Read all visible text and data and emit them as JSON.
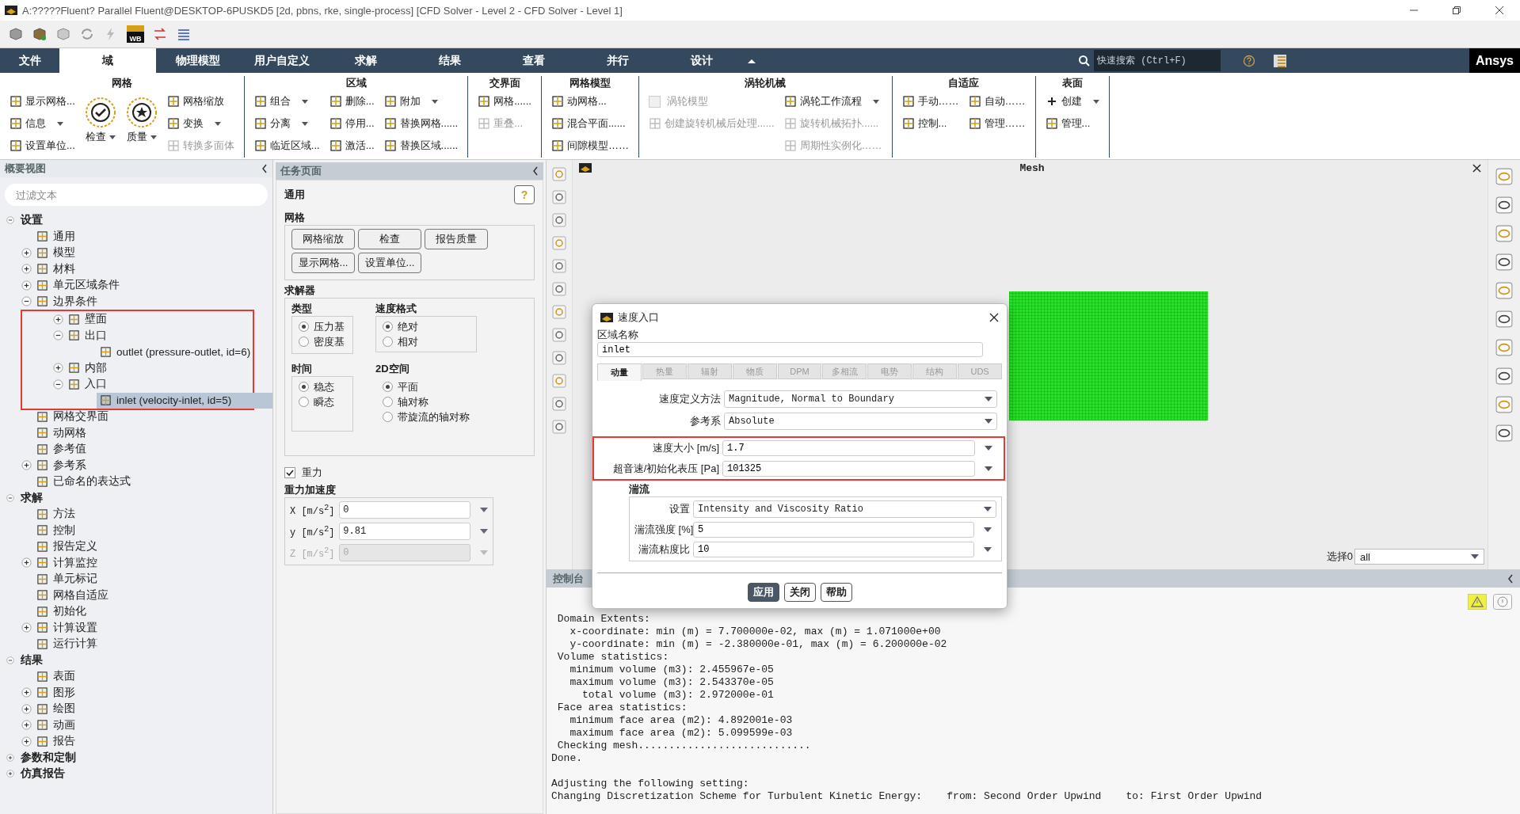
{
  "window": {
    "title": "A:?????Fluent? Parallel Fluent@DESKTOP-6PUSKD5  [2d, pbns, rke, single-process] [CFD Solver - Level 2 - CFD Solver - Level 1]"
  },
  "quick_toolbar": {
    "logo_label": "WB"
  },
  "menu_tabs": [
    {
      "label": "文件",
      "selected": false
    },
    {
      "label": "域",
      "selected": true
    },
    {
      "label": "物理模型",
      "selected": false
    },
    {
      "label": "用户自定义",
      "selected": false
    },
    {
      "label": "求解",
      "selected": false
    },
    {
      "label": "结果",
      "selected": false
    },
    {
      "label": "查看",
      "selected": false
    },
    {
      "label": "并行",
      "selected": false
    },
    {
      "label": "设计",
      "selected": false
    }
  ],
  "search": {
    "placeholder": "快速搜索 (Ctrl+F)"
  },
  "brand": "Ansys",
  "ribbon": [
    {
      "title": "网格",
      "columns": [
        [
          {
            "kind": "small",
            "label": "显示网格...",
            "caret": false,
            "disabled": false
          },
          {
            "kind": "small",
            "label": "信息",
            "caret": true,
            "disabled": false
          },
          {
            "kind": "small",
            "label": "设置单位...",
            "caret": false,
            "disabled": false
          }
        ],
        [
          {
            "kind": "check",
            "label": "检查",
            "caret": true,
            "disabled": false
          }
        ],
        [
          {
            "kind": "star",
            "label": "质量",
            "caret": true,
            "disabled": false
          }
        ],
        [
          {
            "kind": "small",
            "label": "网格缩放",
            "caret": false,
            "disabled": false
          },
          {
            "kind": "small",
            "label": "变换",
            "caret": true,
            "disabled": false
          },
          {
            "kind": "small",
            "label": "转换多面体",
            "caret": false,
            "disabled": true
          }
        ]
      ]
    },
    {
      "title": "区域",
      "columns": [
        [
          {
            "kind": "small",
            "label": "组合",
            "caret": true,
            "disabled": false
          },
          {
            "kind": "small",
            "label": "分离",
            "caret": true,
            "disabled": false
          },
          {
            "kind": "small",
            "label": "临近区域...",
            "caret": false,
            "disabled": false
          }
        ],
        [
          {
            "kind": "small",
            "label": "删除...",
            "caret": false,
            "disabled": false
          },
          {
            "kind": "small",
            "label": "停用...",
            "caret": false,
            "disabled": false
          },
          {
            "kind": "small",
            "label": "激活...",
            "caret": false,
            "disabled": false
          }
        ],
        [
          {
            "kind": "small",
            "label": "附加",
            "caret": true,
            "disabled": false
          },
          {
            "kind": "small",
            "label": "替换网格......",
            "caret": false,
            "disabled": false
          },
          {
            "kind": "small",
            "label": "替换区域......",
            "caret": false,
            "disabled": false
          }
        ]
      ]
    },
    {
      "title": "交界面",
      "columns": [
        [
          {
            "kind": "small",
            "label": "网格......",
            "caret": false,
            "disabled": false
          },
          {
            "kind": "small",
            "label": "重叠...",
            "caret": false,
            "disabled": true
          }
        ]
      ]
    },
    {
      "title": "网格模型",
      "columns": [
        [
          {
            "kind": "small",
            "label": "动网格...",
            "caret": false,
            "disabled": false
          },
          {
            "kind": "small",
            "label": "混合平面......",
            "caret": false,
            "disabled": false
          },
          {
            "kind": "small",
            "label": "间隙模型……",
            "caret": false,
            "disabled": false
          }
        ]
      ]
    },
    {
      "title": "涡轮机械",
      "columns": [
        [
          {
            "kind": "checkbox",
            "label": "涡轮模型",
            "checked": false,
            "caret": false,
            "disabled": true
          },
          {
            "kind": "small",
            "label": "创建旋转机械后处理......",
            "caret": false,
            "disabled": true
          }
        ],
        [
          {
            "kind": "small",
            "label": "涡轮工作流程",
            "caret": true,
            "disabled": false
          },
          {
            "kind": "small",
            "label": "旋转机械拓扑......",
            "caret": false,
            "disabled": true
          },
          {
            "kind": "small",
            "label": "周期性实例化……",
            "caret": false,
            "disabled": true
          }
        ]
      ]
    },
    {
      "title": "自适应",
      "columns": [
        [
          {
            "kind": "small",
            "label": "手动……",
            "caret": false,
            "disabled": false
          },
          {
            "kind": "small",
            "label": "控制...",
            "caret": false,
            "disabled": false
          }
        ],
        [
          {
            "kind": "small",
            "label": "自动……",
            "caret": false,
            "disabled": false
          },
          {
            "kind": "small",
            "label": "管理……",
            "caret": false,
            "disabled": false
          }
        ]
      ]
    },
    {
      "title": "表面",
      "columns": [
        [
          {
            "kind": "plus",
            "label": "创建",
            "caret": true,
            "disabled": false
          },
          {
            "kind": "small",
            "label": "管理...",
            "caret": false,
            "disabled": false
          }
        ]
      ]
    }
  ],
  "outline": {
    "title": "概要视图",
    "filter_placeholder": "过滤文本"
  },
  "tree": [
    {
      "label": "设置",
      "expanded": true,
      "selected": false,
      "children": [
        {
          "label": "通用",
          "selected": false
        },
        {
          "label": "模型",
          "expanded": false,
          "selected": false
        },
        {
          "label": "材料",
          "expanded": false,
          "selected": false
        },
        {
          "label": "单元区域条件",
          "expanded": false,
          "selected": false
        },
        {
          "label": "边界条件",
          "expanded": true,
          "selected": false,
          "highlighted": true,
          "children": [
            {
              "label": "壁面",
              "expanded": false,
              "selected": false
            },
            {
              "label": "出口",
              "expanded": true,
              "selected": false,
              "children": [
                {
                  "label": "outlet (pressure-outlet, id=6)",
                  "selected": false
                }
              ]
            },
            {
              "label": "内部",
              "expanded": false,
              "selected": false
            },
            {
              "label": "入口",
              "expanded": true,
              "selected": false,
              "children": [
                {
                  "label": "inlet (velocity-inlet, id=5)",
                  "selected": true
                }
              ]
            }
          ]
        },
        {
          "label": "网格交界面",
          "selected": false
        },
        {
          "label": "动网格",
          "selected": false
        },
        {
          "label": "参考值",
          "selected": false
        },
        {
          "label": "参考系",
          "expanded": false,
          "selected": false
        },
        {
          "label": "已命名的表达式",
          "selected": false
        }
      ]
    },
    {
      "label": "求解",
      "expanded": true,
      "selected": false,
      "children": [
        {
          "label": "方法",
          "selected": false
        },
        {
          "label": "控制",
          "selected": false
        },
        {
          "label": "报告定义",
          "selected": false
        },
        {
          "label": "计算监控",
          "expanded": false,
          "selected": false
        },
        {
          "label": "单元标记",
          "selected": false
        },
        {
          "label": "网格自适应",
          "selected": false
        },
        {
          "label": "初始化",
          "selected": false
        },
        {
          "label": "计算设置",
          "expanded": false,
          "selected": false
        },
        {
          "label": "运行计算",
          "selected": false
        }
      ]
    },
    {
      "label": "结果",
      "expanded": true,
      "selected": false,
      "children": [
        {
          "label": "表面",
          "selected": false
        },
        {
          "label": "图形",
          "expanded": false,
          "selected": false
        },
        {
          "label": "绘图",
          "expanded": false,
          "selected": false
        },
        {
          "label": "动画",
          "expanded": false,
          "selected": false
        },
        {
          "label": "报告",
          "expanded": false,
          "selected": false
        }
      ]
    },
    {
      "label": "参数和定制",
      "expanded": false,
      "selected": false
    },
    {
      "label": "仿真报告",
      "expanded": false,
      "selected": false
    }
  ],
  "task_page": {
    "title": "任务页面",
    "heading": "通用",
    "help": "?",
    "mesh": {
      "title": "网格",
      "buttons": [
        "网格缩放",
        "检查",
        "报告质量",
        "显示网格...",
        "设置单位..."
      ]
    },
    "solver": {
      "title": "求解器",
      "groups": [
        {
          "title": "类型",
          "options": [
            {
              "label": "压力基",
              "selected": true
            },
            {
              "label": "密度基",
              "selected": false
            }
          ]
        },
        {
          "title": "速度格式",
          "options": [
            {
              "label": "绝对",
              "selected": true
            },
            {
              "label": "相对",
              "selected": false
            }
          ]
        },
        {
          "title": "时间",
          "options": [
            {
              "label": "稳态",
              "selected": true
            },
            {
              "label": "瞬态",
              "selected": false
            }
          ]
        },
        {
          "title": "2D空间",
          "options": [
            {
              "label": "平面",
              "selected": true
            },
            {
              "label": "轴对称",
              "selected": false
            },
            {
              "label": "带旋流的轴对称",
              "selected": false
            }
          ]
        }
      ]
    },
    "gravity": {
      "label": "重力",
      "checked": true
    },
    "gravity_acceleration": {
      "title": "重力加速度",
      "fields": [
        {
          "label": "X [m/s$^{2}$]",
          "value": "0",
          "disabled": false
        },
        {
          "label": "y [m/s$^{2}$]",
          "value": "9.81",
          "disabled": false
        },
        {
          "label": "Z [m/s$^{2}$]",
          "value": "0",
          "disabled": true
        }
      ]
    }
  },
  "graphics": {
    "title": "Mesh",
    "selection_label": "选择0",
    "selection_value": "all"
  },
  "console": {
    "title": "控制台",
    "lines": [
      " Domain Extents:",
      "   x-coordinate: min (m) = 7.700000e-02, max (m) = 1.071000e+00",
      "   y-coordinate: min (m) = -2.380000e-01, max (m) = 6.200000e-02",
      " Volume statistics:",
      "   minimum volume (m3): 2.455967e-05",
      "   maximum volume (m3): 2.543370e-05",
      "     total volume (m3): 2.972000e-01",
      " Face area statistics:",
      "   minimum face area (m2): 4.892001e-03",
      "   maximum face area (m2): 5.099599e-03",
      " Checking mesh............................",
      "Done."
    ],
    "lines_after": [
      "Adjusting the following setting:",
      "Changing Discretization Scheme for Turbulent Kinetic Energy:    from: Second Order Upwind    to: First Order Upwind"
    ]
  },
  "dialog": {
    "title": "速度入口",
    "zone_label": "区域名称",
    "zone_value": "inlet",
    "tabs": [
      {
        "label": "动量",
        "selected": true
      },
      {
        "label": "热量",
        "selected": false
      },
      {
        "label": "辐射",
        "selected": false
      },
      {
        "label": "物质",
        "selected": false
      },
      {
        "label": "DPM",
        "selected": false
      },
      {
        "label": "多相流",
        "selected": false
      },
      {
        "label": "电势",
        "selected": false
      },
      {
        "label": "结构",
        "selected": false
      },
      {
        "label": "UDS",
        "selected": false
      }
    ],
    "groups": [
      {
        "highlighted": false,
        "rows": [
          {
            "kind": "select",
            "label": "速度定义方法",
            "value": "Magnitude, Normal to Boundary"
          },
          {
            "kind": "select",
            "label": "参考系",
            "value": "Absolute"
          }
        ]
      },
      {
        "highlighted": true,
        "rows": [
          {
            "kind": "input",
            "label": "速度大小 [m/s]",
            "value": "1.7"
          },
          {
            "kind": "input",
            "label": "超音速/初始化表压 [Pa]",
            "value": "101325"
          }
        ]
      }
    ],
    "turbulence": {
      "title": "湍流",
      "rows": [
        {
          "kind": "select",
          "label": "设置",
          "value": "Intensity and Viscosity Ratio"
        },
        {
          "kind": "input",
          "label": "湍流强度 [%]",
          "value": "5"
        },
        {
          "kind": "input",
          "label": "湍流粘度比",
          "value": "10"
        }
      ]
    },
    "buttons": [
      {
        "label": "应用",
        "primary": true
      },
      {
        "label": "关闭",
        "primary": false
      },
      {
        "label": "帮助",
        "primary": false
      }
    ]
  }
}
